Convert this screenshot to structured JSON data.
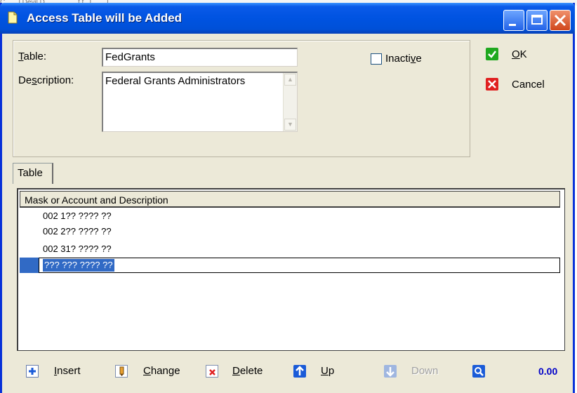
{
  "window": {
    "title": "Access Table will be Added",
    "behind_text": "C...  ...l Devil D...    ...  ...  .  ...t t...l  ...  ...l"
  },
  "form": {
    "table_label_prefix": "",
    "table_label_key": "T",
    "table_label_rest": "able:",
    "table_value": "FedGrants",
    "description_label_pre": "De",
    "description_label_key": "s",
    "description_label_rest": "cription:",
    "description_value": "Federal Grants Administrators",
    "inactive_pre": "Inacti",
    "inactive_key": "v",
    "inactive_rest": "e",
    "inactive_checked": false
  },
  "actions": {
    "ok_key": "O",
    "ok_rest": "K",
    "cancel_label": "Cancel"
  },
  "tabs": [
    {
      "label": "Table",
      "active": true
    }
  ],
  "grid": {
    "column_header": "Mask or Account and Description",
    "rows": [
      "002 1?? ???? ??",
      "002 2?? ???? ??",
      "002 31? ???? ??",
      "??? ??? ???? ??"
    ],
    "selected_index": 3
  },
  "toolbar": {
    "insert_key": "I",
    "insert_rest": "nsert",
    "change_key": "C",
    "change_rest": "hange",
    "delete_key": "D",
    "delete_rest": "elete",
    "up_key": "U",
    "up_rest": "p",
    "down_label": "Down",
    "total": "0.00"
  },
  "colors": {
    "title_bar": "#0053e1",
    "selection": "#316ac5",
    "total_text": "#0000c8"
  }
}
